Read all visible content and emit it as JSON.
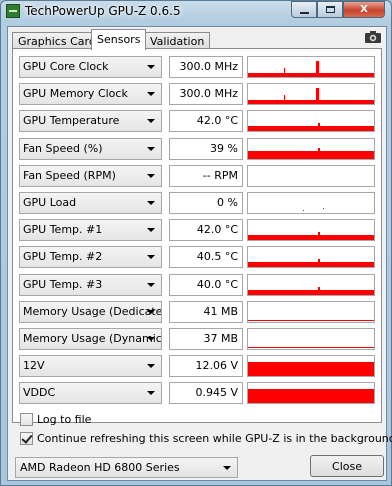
{
  "window": {
    "title": "TechPowerUp GPU-Z 0.6.5"
  },
  "window_controls": {
    "close_glyph": "X"
  },
  "tabs": [
    {
      "label": "Graphics Card",
      "active": false
    },
    {
      "label": "Sensors",
      "active": true
    },
    {
      "label": "Validation",
      "active": false
    }
  ],
  "screenshot_icon": "camera-icon",
  "sensors": [
    {
      "name": "GPU Core Clock",
      "value": "300.0 MHz",
      "graph": "spike"
    },
    {
      "name": "GPU Memory Clock",
      "value": "300.0 MHz",
      "graph": "spike"
    },
    {
      "name": "GPU Temperature",
      "value": "42.0 °C",
      "graph": "band"
    },
    {
      "name": "Fan Speed (%)",
      "value": "39 %",
      "graph": "band"
    },
    {
      "name": "Fan Speed (RPM)",
      "value": "-- RPM",
      "graph": "empty"
    },
    {
      "name": "GPU Load",
      "value": "0 %",
      "graph": "dots"
    },
    {
      "name": "GPU Temp. #1",
      "value": "42.0 °C",
      "graph": "band"
    },
    {
      "name": "GPU Temp. #2",
      "value": "40.5 °C",
      "graph": "band"
    },
    {
      "name": "GPU Temp. #3",
      "value": "40.0 °C",
      "graph": "band"
    },
    {
      "name": "Memory Usage (Dedicated)",
      "value": "41 MB",
      "graph": "line"
    },
    {
      "name": "Memory Usage (Dynamic)",
      "value": "37 MB",
      "graph": "line"
    },
    {
      "name": "12V",
      "value": "12.06 V",
      "graph": "full"
    },
    {
      "name": "VDDC",
      "value": "0.945 V",
      "graph": "full"
    }
  ],
  "options": {
    "log_to_file": {
      "label": "Log to file",
      "checked": false
    },
    "continue_refresh": {
      "label": "Continue refreshing this screen while GPU-Z is in the background",
      "checked": true
    }
  },
  "gpu_select": {
    "value": "AMD Radeon HD 6800 Series"
  },
  "close_button": {
    "label": "Close"
  },
  "colors": {
    "graph": "#ff0000",
    "window_frame": "#b3cde0"
  }
}
